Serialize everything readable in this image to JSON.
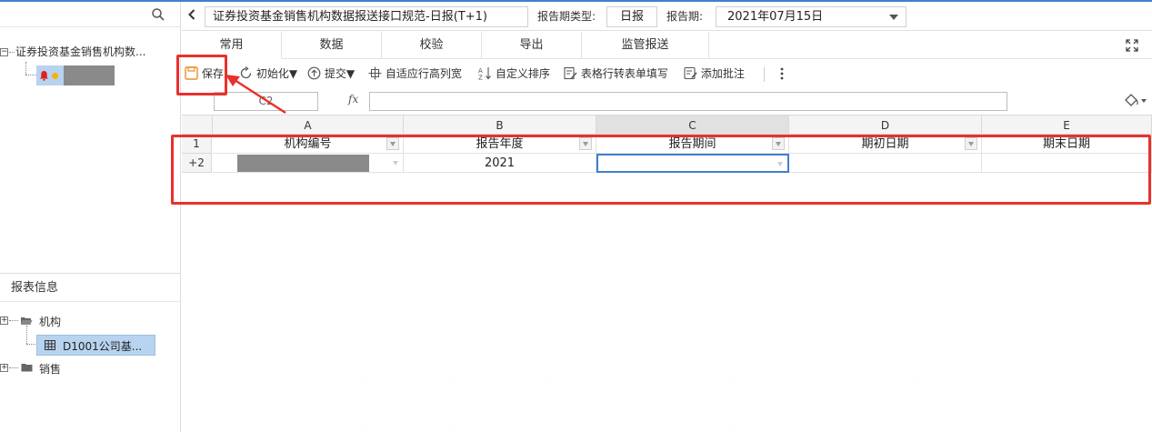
{
  "left_panel": {
    "tree": {
      "root_label": "证券投资基金销售机构数...",
      "child_label": ""
    },
    "info_header": "报表信息",
    "info_tree": [
      {
        "label": "机构",
        "icon": "folder-open-icon"
      },
      {
        "label": "D1001公司基...",
        "icon": "table-icon",
        "selected": true
      },
      {
        "label": "销售",
        "icon": "folder-icon"
      }
    ]
  },
  "titlebar": {
    "report_title": "证券投资基金销售机构数据报送接口规范-日报(T+1)",
    "period_type_label": "报告期类型:",
    "period_type_value": "日报",
    "period_label": "报告期:",
    "period_value": "2021年07月15日"
  },
  "tabs": [
    "常用",
    "数据",
    "校验",
    "导出",
    "监管报送"
  ],
  "toolbar": {
    "save": "保存",
    "init": "初始化▼",
    "submit": "提交▼",
    "autofit": "自适应行高列宽",
    "custom_sort": "自定义排序",
    "row_to_form": "表格行转表单填写",
    "add_note": "添加批注"
  },
  "formula": {
    "cell_ref": "C2",
    "fx": "fx"
  },
  "grid": {
    "columns": [
      "A",
      "B",
      "C",
      "D",
      "E"
    ],
    "rows": [
      {
        "header": "1",
        "cells": [
          "机构编号",
          "报告年度",
          "报告期间",
          "期初日期",
          "期末日期"
        ]
      },
      {
        "header": "+2",
        "cells": [
          "",
          "2021",
          "",
          "",
          ""
        ]
      }
    ]
  },
  "colors": {
    "accent": "#3f7fd0",
    "highlight": "#e8312c",
    "selected_bg": "#b8d3ef"
  }
}
